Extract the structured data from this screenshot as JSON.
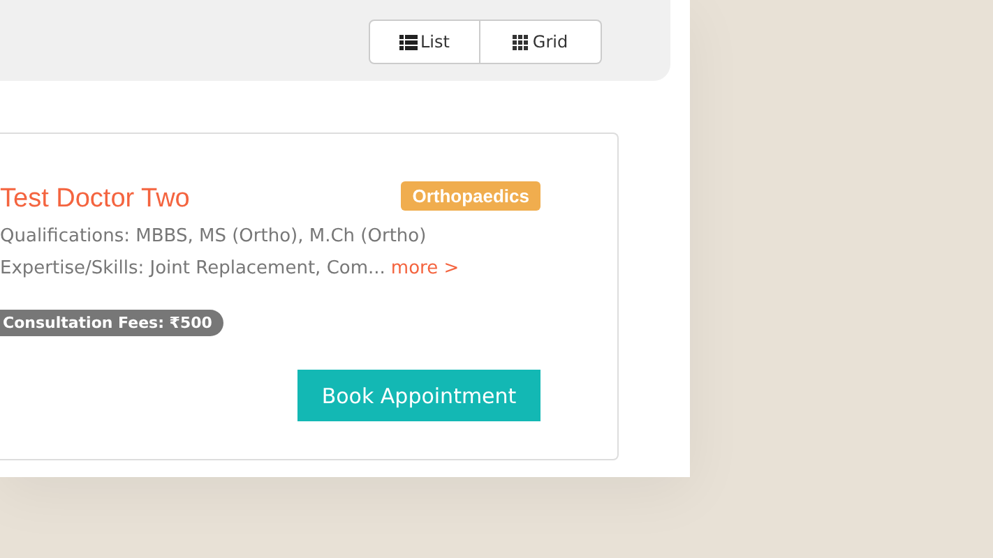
{
  "view_toggle": [
    {
      "label": "List",
      "kind": "list"
    },
    {
      "label": "Grid",
      "kind": "grid"
    }
  ],
  "doctor": {
    "name": "Test Doctor Two",
    "specialty": "Orthopaedics",
    "qualifications": "Qualifications: MBBS, MS (Ortho), M.Ch (Ortho)",
    "expertise": "Expertise/Skills: Joint Replacement, Com...",
    "more_link": "more >",
    "fees": "Consultation Fees: ₹500",
    "book_button": "Book Appointment"
  }
}
